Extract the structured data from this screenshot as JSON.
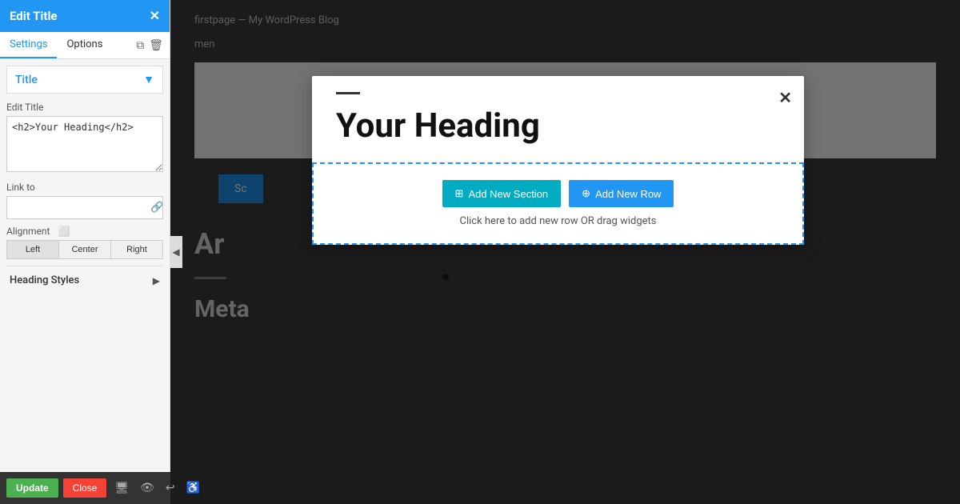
{
  "sidebar": {
    "header_title": "Edit Title",
    "close_icon": "✕",
    "tabs": [
      {
        "id": "settings",
        "label": "Settings",
        "active": true
      },
      {
        "id": "options",
        "label": "Options",
        "active": false
      }
    ],
    "widget_type": "Title",
    "edit_title_label": "Edit Title",
    "textarea_value": "<h2>Your Heading</h2>",
    "link_to_label": "Link to",
    "link_input_value": "",
    "link_input_placeholder": "",
    "alignment_label": "Alignment",
    "align_buttons": [
      "Left",
      "Center",
      "Right"
    ],
    "heading_styles_label": "Heading Styles",
    "copy_icon": "⧉",
    "trash_icon": "🗑"
  },
  "popup": {
    "heading_bar": "",
    "heading_text": "Your Heading",
    "close_icon": "✕",
    "btn_add_section_label": "Add New Section",
    "btn_add_row_label": "Add New Row",
    "hint_text": "Click here to add new row OR drag widgets"
  },
  "background": {
    "breadcrumb": "firstpage — My WordPress Blog",
    "menu_text": "men",
    "sc_text": "Sc",
    "heading_2": "Ar",
    "heading_3": "Meta"
  },
  "toolbar": {
    "update_label": "Update",
    "close_label": "Close"
  },
  "colors": {
    "primary_blue": "#2196F3",
    "teal": "#00acc1",
    "green": "#4CAF50",
    "red": "#f44336"
  }
}
